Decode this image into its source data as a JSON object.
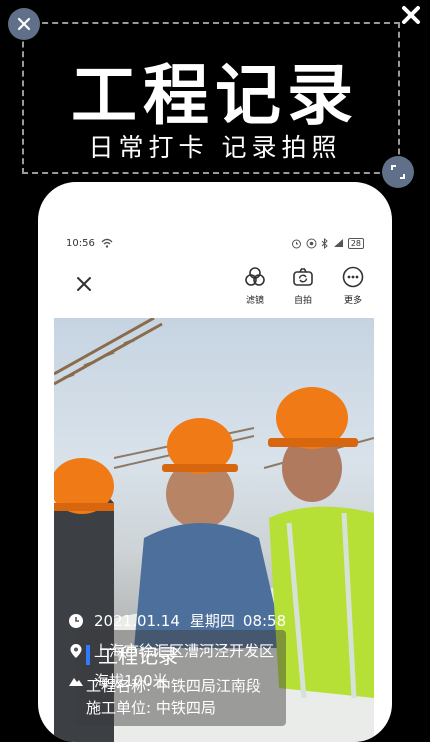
{
  "hero": {
    "title": "工程记录",
    "subtitle": "日常打卡 记录拍照"
  },
  "statusbar": {
    "time": "10:56",
    "battery": "28"
  },
  "toolbar": {
    "filter_label": "滤镜",
    "selfie_label": "自拍",
    "more_label": "更多"
  },
  "watermark": {
    "title": "工程记录",
    "project_name": "工程名称: 中铁四局江南段",
    "construction_unit": "施工单位: 中铁四局"
  },
  "info": {
    "date": "2021.01.14",
    "weekday": "星期四",
    "time": "08:58",
    "location": "上海市徐汇区漕河泾开发区",
    "altitude": "海拔100米"
  },
  "colors": {
    "accent": "#2f7bff",
    "badge": "#5f7088"
  }
}
